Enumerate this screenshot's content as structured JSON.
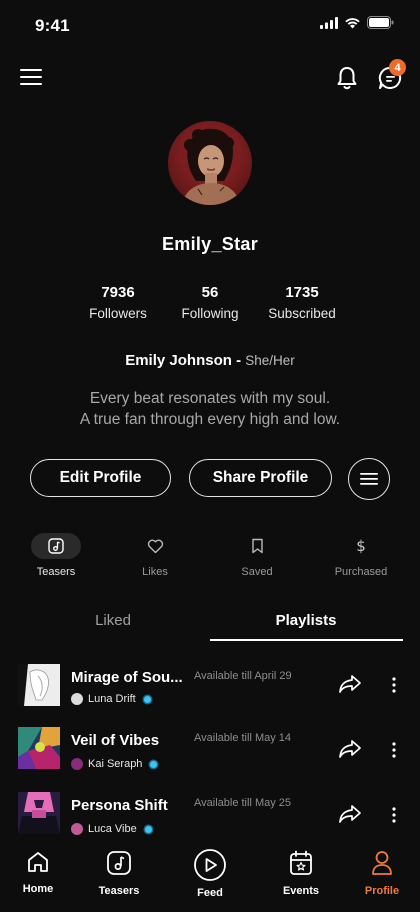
{
  "status": {
    "time": "9:41"
  },
  "header": {
    "notification_badge": "4"
  },
  "profile": {
    "username": "Emily_Star",
    "stats": [
      {
        "num": "7936",
        "label": "Followers"
      },
      {
        "num": "56",
        "label": "Following"
      },
      {
        "num": "1735",
        "label": "Subscribed"
      }
    ],
    "full_name": "Emily Johnson -",
    "pronouns": "She/Her",
    "bio_line1": "Every beat resonates with my soul.",
    "bio_line2": "A true fan through every high and low.",
    "edit_label": "Edit Profile",
    "share_label": "Share Profile"
  },
  "profile_tabs": [
    {
      "label": "Teasers",
      "icon": "music-note-icon",
      "active": true
    },
    {
      "label": "Likes",
      "icon": "heart-icon"
    },
    {
      "label": "Saved",
      "icon": "bookmark-icon"
    },
    {
      "label": "Purchased",
      "icon": "dollar-icon"
    }
  ],
  "sub_tabs": {
    "liked": "Liked",
    "playlists": "Playlists",
    "active": "Playlists"
  },
  "playlists": [
    {
      "title": "Mirage of Sou...",
      "artist": "Luna Drift",
      "availability": "Available till April 29"
    },
    {
      "title": "Veil of Vibes",
      "artist": "Kai Seraph",
      "availability": "Available till May 14"
    },
    {
      "title": "Persona Shift",
      "artist": "Luca Vibe",
      "availability": "Available till May 25"
    }
  ],
  "bottom_nav": [
    {
      "label": "Home",
      "icon": "home-icon"
    },
    {
      "label": "Teasers",
      "icon": "music-note-icon"
    },
    {
      "label": "Feed",
      "icon": "play-icon"
    },
    {
      "label": "Events",
      "icon": "calendar-icon"
    },
    {
      "label": "Profile",
      "icon": "user-icon",
      "active": true
    }
  ],
  "colors": {
    "accent": "#f07a3e",
    "badge": "#f06b2a",
    "verified": "#38c6f4"
  }
}
